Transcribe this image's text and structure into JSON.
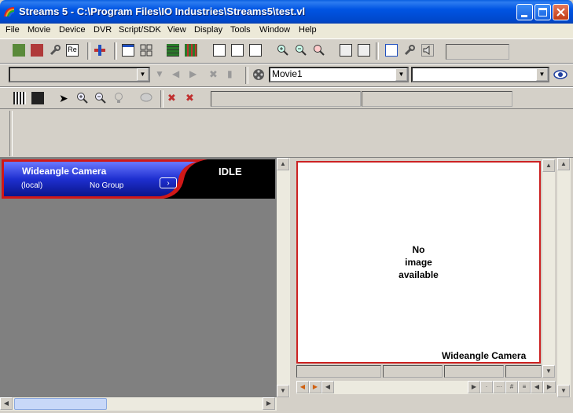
{
  "window": {
    "title": "Streams 5 - C:\\Program Files\\IO Industries\\Streams5\\test.vl"
  },
  "menu": [
    "File",
    "Movie",
    "Device",
    "DVR",
    "Script/SDK",
    "View",
    "Display",
    "Tools",
    "Window",
    "Help"
  ],
  "toolbar1": {
    "re_label": "Re"
  },
  "toolbar2": {
    "movie_select": "Movie1",
    "second_select": ""
  },
  "camera": {
    "name": "Wideangle Camera",
    "location": "(local)",
    "group": "No Group",
    "state": "IDLE",
    "go_glyph": "›"
  },
  "viewer": {
    "no_image_line1": "No",
    "no_image_line2": "image",
    "no_image_line3": "available",
    "camera_label": "Wideangle Camera"
  },
  "colors": {
    "title_bar": "#0054e3",
    "panel_bg": "#d4d0c8",
    "camera_blue": "#1e2fd0",
    "frame_red": "#cc2222"
  }
}
